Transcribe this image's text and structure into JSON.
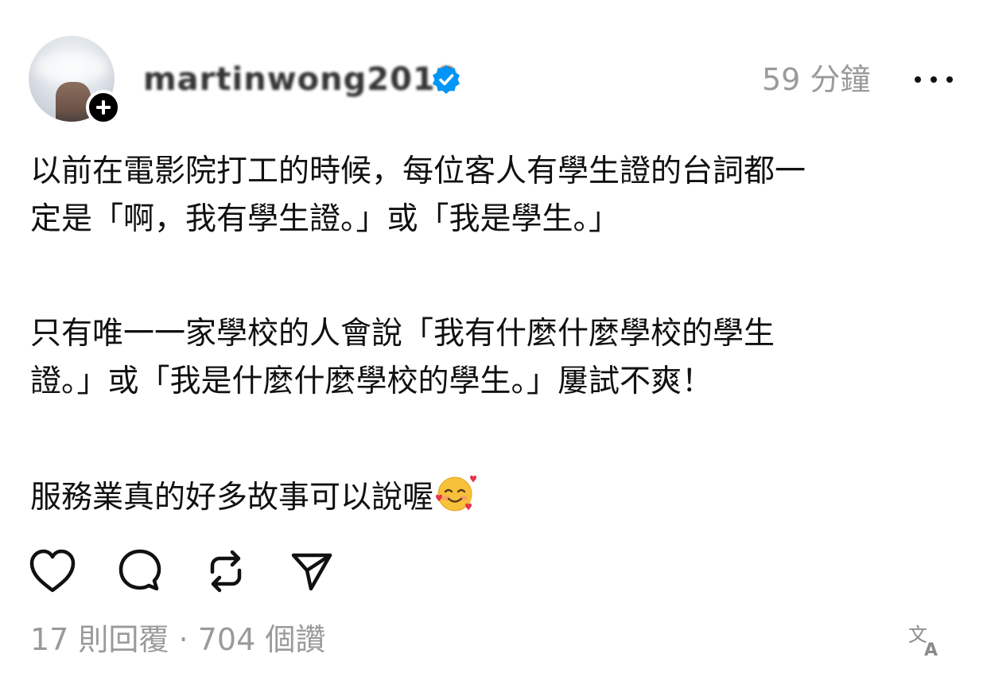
{
  "post": {
    "username": "martinwong2010",
    "time": "59 分鐘",
    "paragraphs": [
      "以前在電影院打工的時候，每位客人有學生證的台詞都一\n定是「啊，我有學生證。」或「我是學生。」",
      "只有唯一一家學校的人會說「我有什麼什麼學校的學生\n證。」或「我是什麼什麼學校的學生。」屢試不爽！",
      "服務業真的好多故事可以說喔"
    ],
    "emoji": "smiling-face-with-hearts",
    "replies": "17 則回覆",
    "separator": "·",
    "likes": "704 個讚"
  },
  "icons": {
    "verified": "verified-badge-icon",
    "follow": "plus-icon",
    "more": "more-dots-icon",
    "like": "heart-icon",
    "comment": "comment-icon",
    "repost": "repost-icon",
    "share": "send-icon",
    "translate": "translate-icon"
  },
  "colors": {
    "text": "#111111",
    "muted": "#9a9a9a",
    "verified": "#0095f6"
  }
}
